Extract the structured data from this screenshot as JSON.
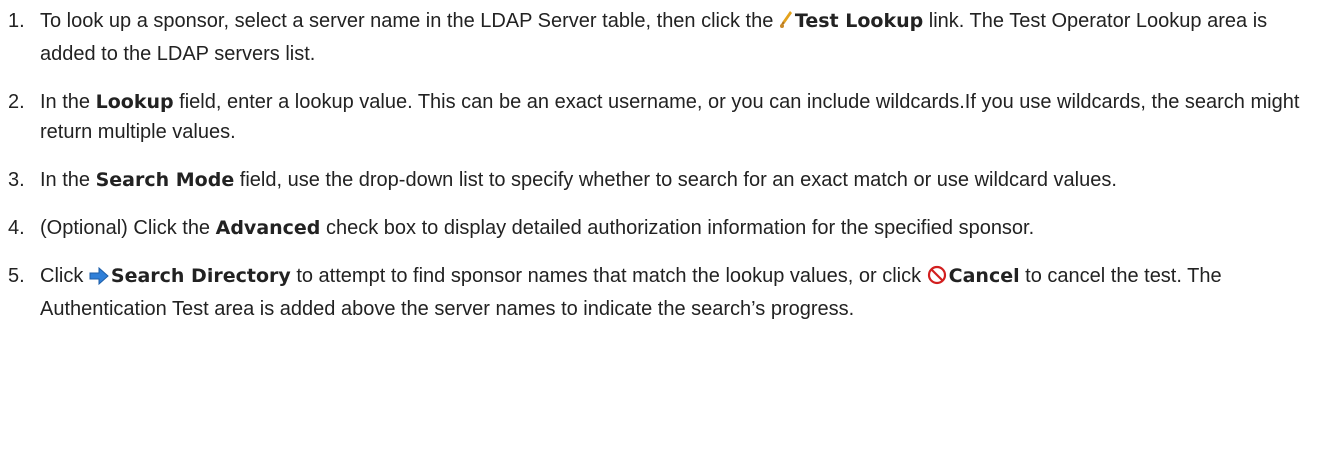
{
  "steps": [
    {
      "number": "1.",
      "t1": "To look up a sponsor, select a server name in the LDAP Server table, then click the ",
      "icon": "test-lookup-icon",
      "b1": "Test Lookup",
      "t2": " link. The Test Operator Lookup area is added to the LDAP servers list."
    },
    {
      "number": "2.",
      "t1": "In the ",
      "b1": "Lookup",
      "t2": " field, enter a lookup value. This can be an exact username, or you can include wildcards.If you use wildcards, the search might return multiple values."
    },
    {
      "number": "3.",
      "t1": "In the ",
      "b1": "Search Mode",
      "t2": " field, use the drop-down list to specify whether to search for an exact match or use wildcard values."
    },
    {
      "number": "4.",
      "t1": "(Optional) Click the ",
      "b1": "Advanced",
      "t2": " check box to display detailed authorization information for the specified sponsor."
    },
    {
      "number": "5.",
      "t1": "Click ",
      "icon1": "arrow-right-icon",
      "b1": "Search Directory",
      "t2": " to attempt to find sponsor names that match the lookup values, or click ",
      "icon2": "cancel-icon",
      "b2": "Cancel",
      "t3": " to cancel the test. The Authentication Test area is added above the server names to indicate the search’s progress."
    }
  ],
  "colors": {
    "text": "#222222",
    "arrow_icon": "#2f7fd8",
    "cancel_icon": "#d21f1f",
    "lookup_icon": "#e3a21c"
  }
}
